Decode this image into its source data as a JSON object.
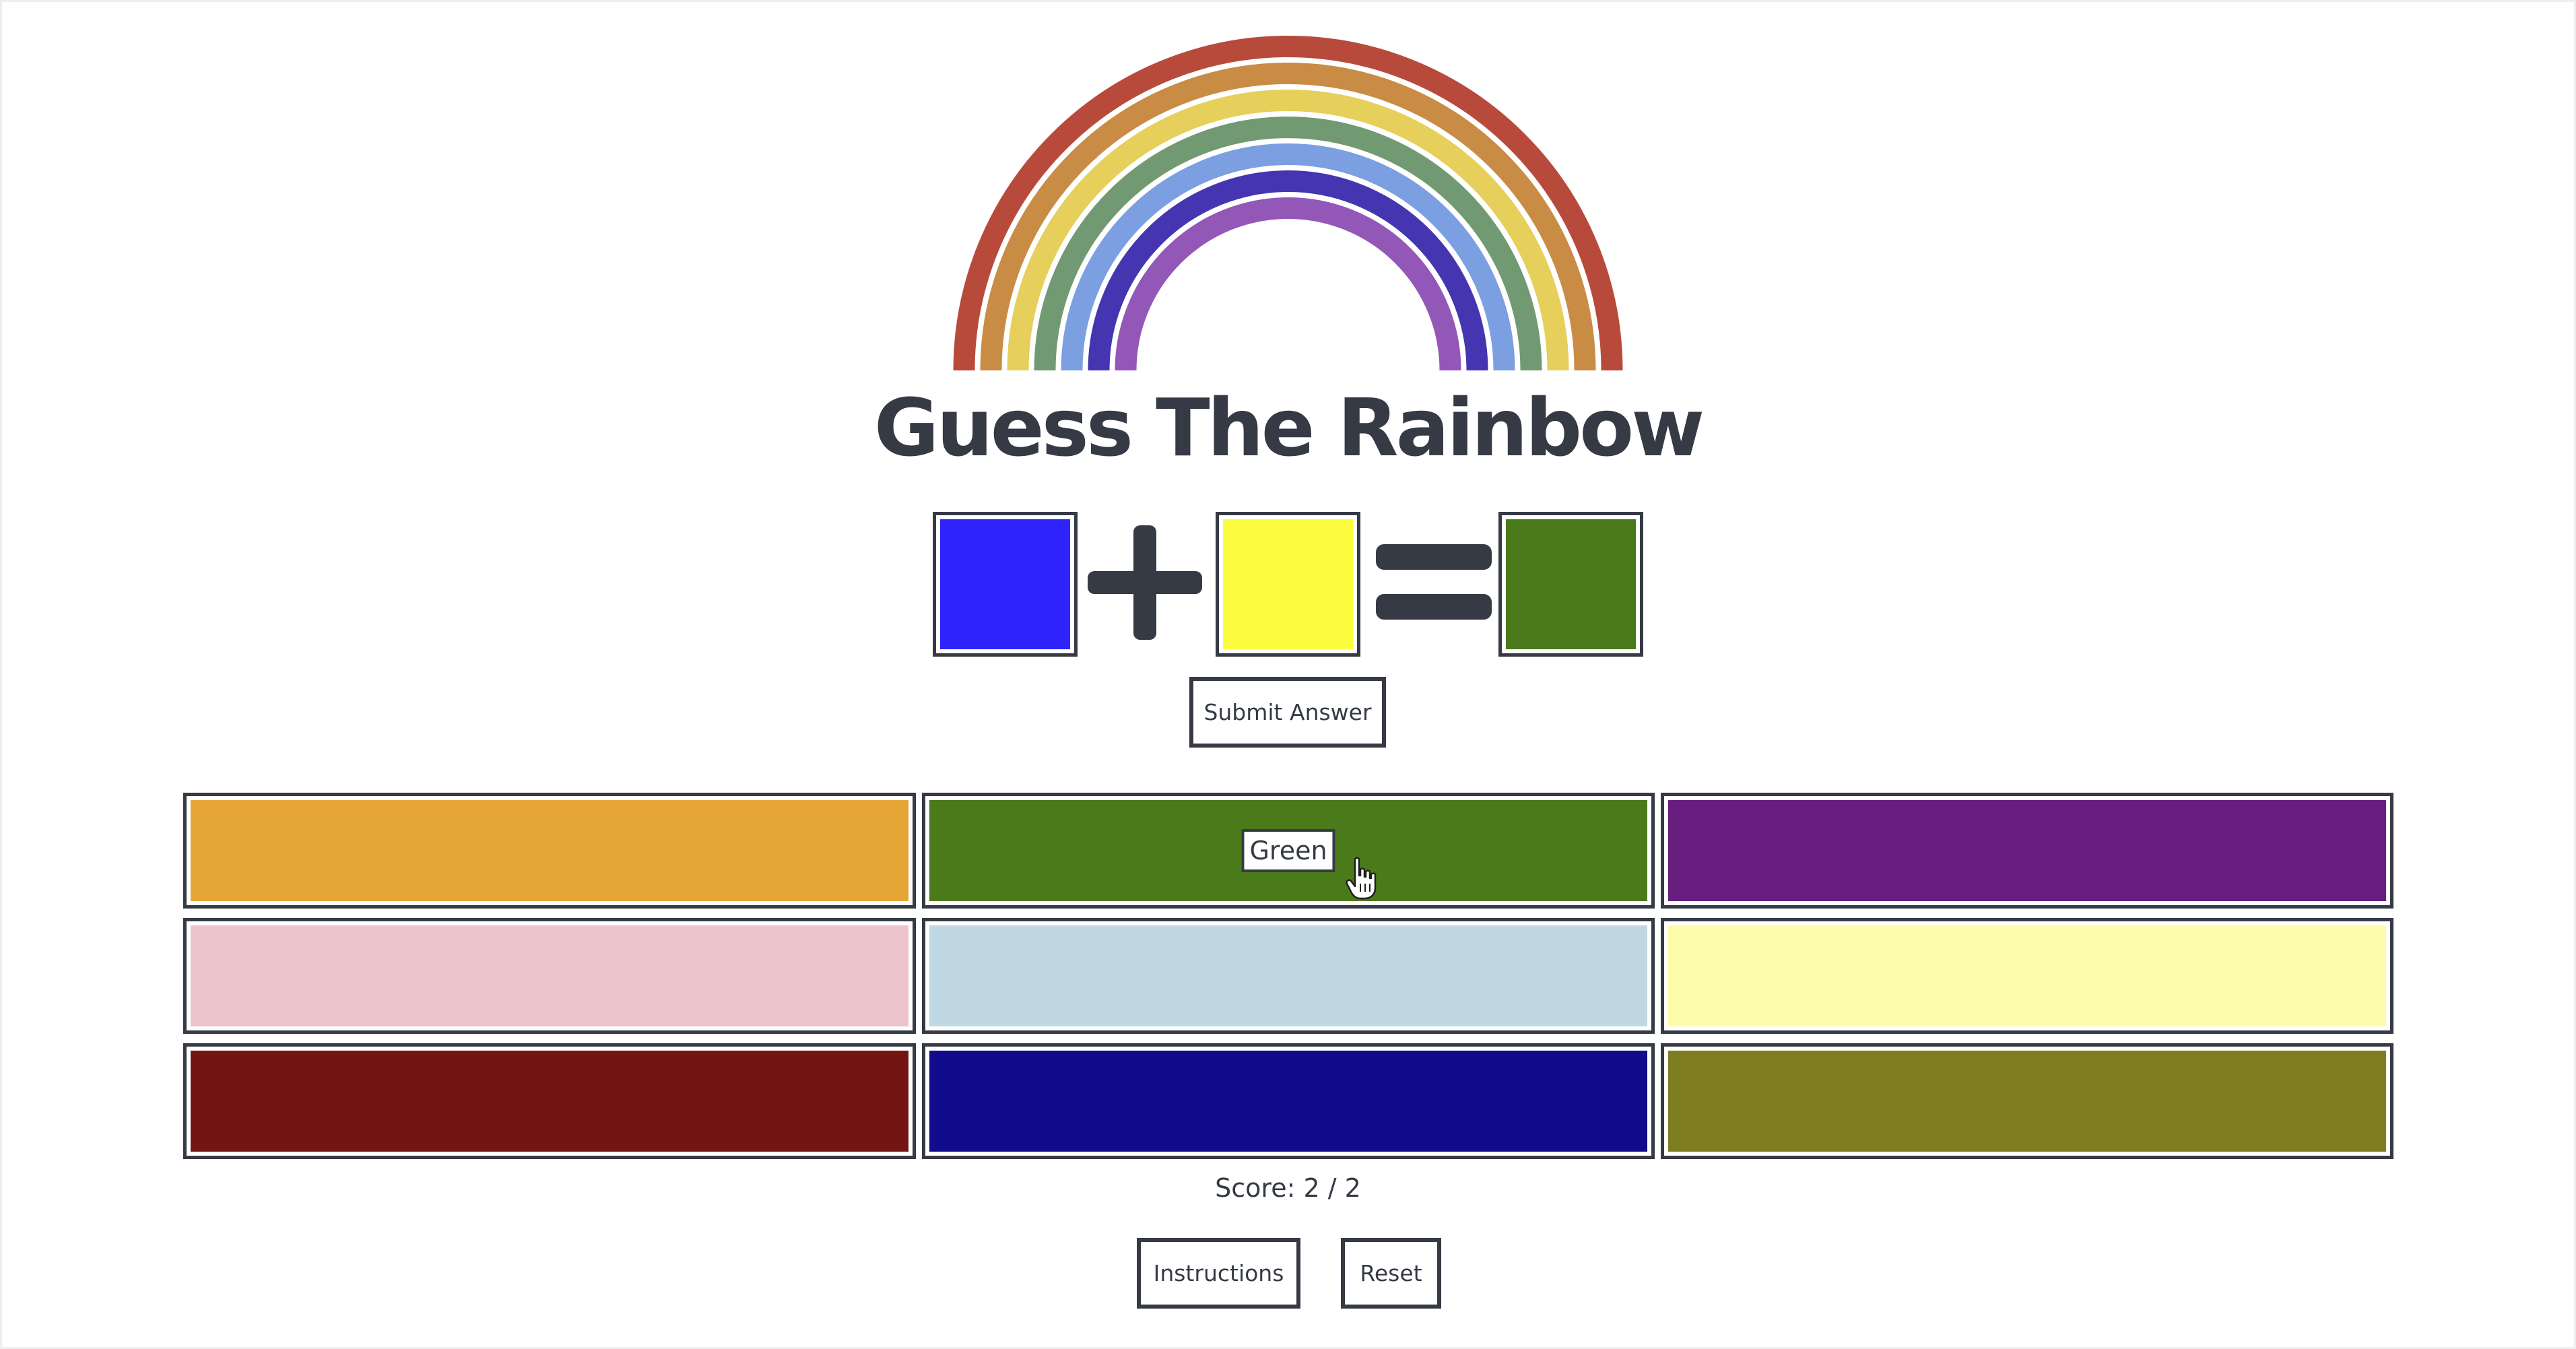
{
  "title": "Guess The Rainbow",
  "rainbow": {
    "band_colors": [
      "#b84a3c",
      "#c98c45",
      "#e6cf5a",
      "#729a72",
      "#7b9fe0",
      "#4535b0",
      "#9357b8"
    ]
  },
  "equation": {
    "operand_a_color": "#2e23fb",
    "operator_1": "plus-icon",
    "operand_b_color": "#fcfd3e",
    "operator_2": "equals-icon",
    "result_color": "#4a7a19"
  },
  "submit_button": {
    "label": "Submit Answer"
  },
  "color_options": [
    {
      "color": "#e5a636",
      "label": ""
    },
    {
      "color": "#4a7a19",
      "label": "Green",
      "hovered": true
    },
    {
      "color": "#681e7f",
      "label": ""
    },
    {
      "color": "#edc4cb",
      "label": ""
    },
    {
      "color": "#c0d8e2",
      "label": ""
    },
    {
      "color": "#fdfcab",
      "label": ""
    },
    {
      "color": "#731510",
      "label": ""
    },
    {
      "color": "#120c8c",
      "label": ""
    },
    {
      "color": "#7e7e21",
      "label": ""
    }
  ],
  "score": {
    "text": "Score: 2 / 2"
  },
  "instructions_button": {
    "label": "Instructions"
  },
  "reset_button": {
    "label": "Reset"
  },
  "colors": {
    "text": "#353a45",
    "background": "#ffffff"
  }
}
